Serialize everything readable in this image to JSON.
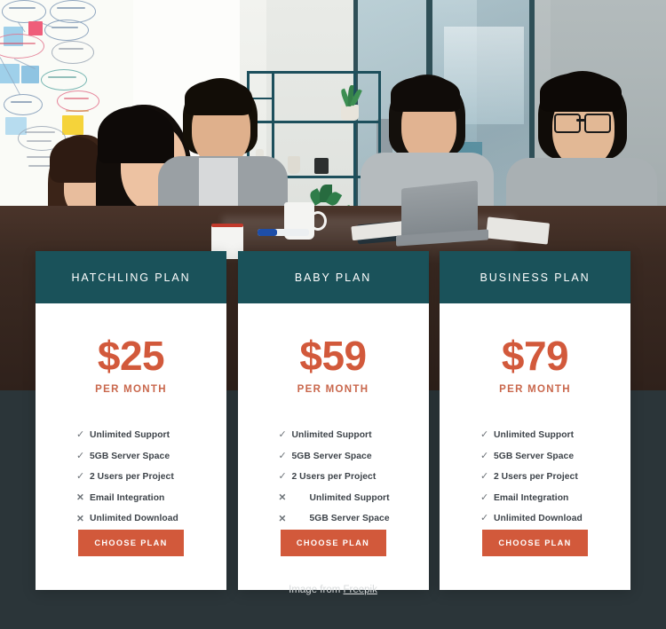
{
  "hero": {
    "alt": "business team meeting at conference table in office"
  },
  "pricing": {
    "cards": [
      {
        "title": "HATCHLING PLAN",
        "price": "$25",
        "period": "PER MONTH",
        "button": "CHOOSE PLAN",
        "features": [
          {
            "icon": "check-icon",
            "glyph": "✓",
            "label": "Unlimited Support",
            "indent": false
          },
          {
            "icon": "check-icon",
            "glyph": "✓",
            "label": "5GB Server Space",
            "indent": false
          },
          {
            "icon": "check-icon",
            "glyph": "✓",
            "label": "2 Users per Project",
            "indent": false
          },
          {
            "icon": "cross-icon",
            "glyph": "✕",
            "label": "Email Integration",
            "indent": false
          },
          {
            "icon": "cross-icon",
            "glyph": "✕",
            "label": "Unlimited Download",
            "indent": false
          }
        ]
      },
      {
        "title": "BABY PLAN",
        "price": "$59",
        "period": "PER MONTH",
        "button": "CHOOSE PLAN",
        "features": [
          {
            "icon": "check-icon",
            "glyph": "✓",
            "label": "Unlimited Support",
            "indent": false
          },
          {
            "icon": "check-icon",
            "glyph": "✓",
            "label": "5GB Server Space",
            "indent": false
          },
          {
            "icon": "check-icon",
            "glyph": "✓",
            "label": "2 Users per Project",
            "indent": false
          },
          {
            "icon": "cross-icon",
            "glyph": "✕",
            "label": "Unlimited Support",
            "indent": true
          },
          {
            "icon": "cross-icon",
            "glyph": "✕",
            "label": "5GB Server Space",
            "indent": true
          }
        ]
      },
      {
        "title": "BUSINESS PLAN",
        "price": "$79",
        "period": "PER MONTH",
        "button": "CHOOSE PLAN",
        "features": [
          {
            "icon": "check-icon",
            "glyph": "✓",
            "label": "Unlimited Support",
            "indent": false
          },
          {
            "icon": "check-icon",
            "glyph": "✓",
            "label": "5GB Server Space",
            "indent": false
          },
          {
            "icon": "check-icon",
            "glyph": "✓",
            "label": "2 Users per Project",
            "indent": false
          },
          {
            "icon": "check-icon",
            "glyph": "✓",
            "label": "Email Integration",
            "indent": false
          },
          {
            "icon": "check-icon",
            "glyph": "✓",
            "label": "Unlimited Download",
            "indent": false
          }
        ]
      }
    ]
  },
  "caption": {
    "prefix": "Image from ",
    "link": "Freepik"
  },
  "colors": {
    "header_teal": "#1a525a",
    "accent_orange": "#d2593b",
    "page_background": "#2b3539",
    "card_background": "#ffffff",
    "feature_text": "#3d4349"
  }
}
